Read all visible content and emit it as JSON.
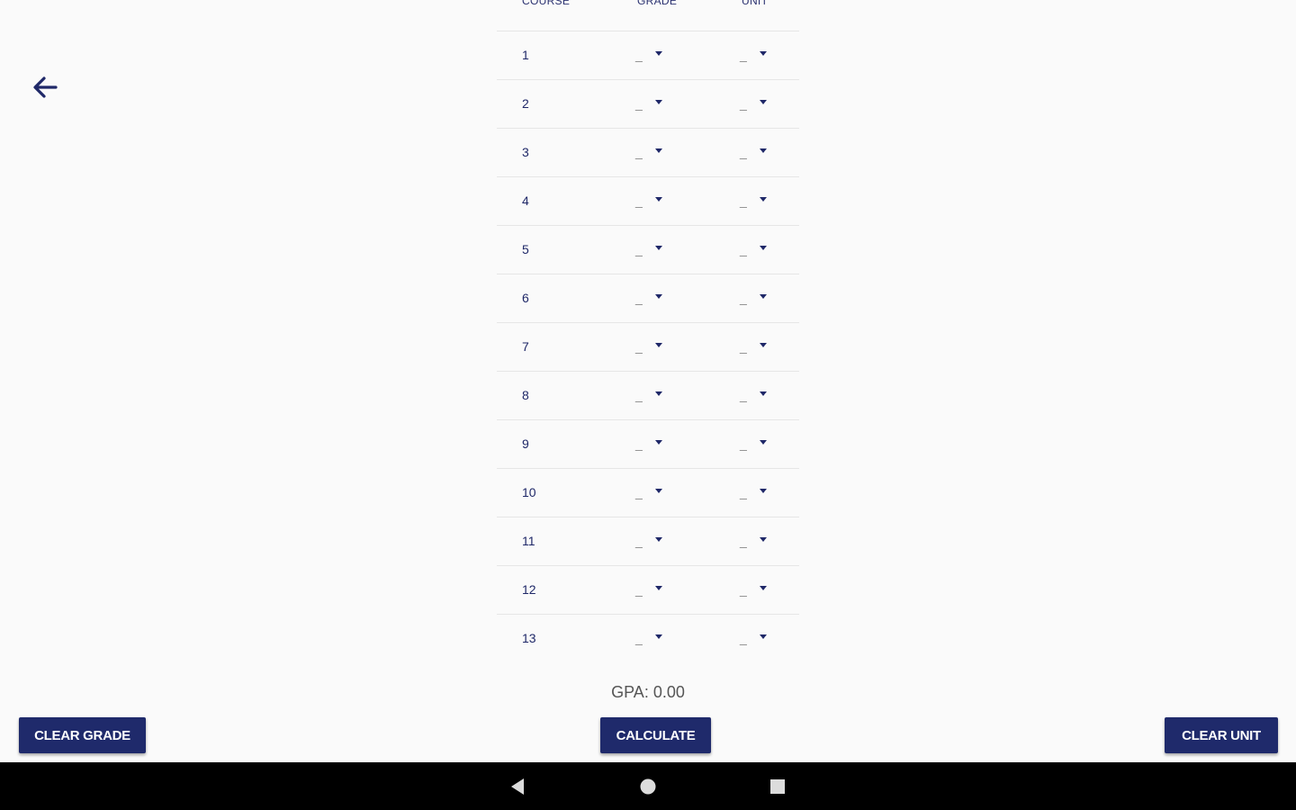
{
  "header": {
    "columns": {
      "course": "COURSE",
      "grade": "GRADE",
      "unit": "UNIT"
    }
  },
  "rows": [
    {
      "course": "1",
      "grade": "_",
      "unit": "_"
    },
    {
      "course": "2",
      "grade": "_",
      "unit": "_"
    },
    {
      "course": "3",
      "grade": "_",
      "unit": "_"
    },
    {
      "course": "4",
      "grade": "_",
      "unit": "_"
    },
    {
      "course": "5",
      "grade": "_",
      "unit": "_"
    },
    {
      "course": "6",
      "grade": "_",
      "unit": "_"
    },
    {
      "course": "7",
      "grade": "_",
      "unit": "_"
    },
    {
      "course": "8",
      "grade": "_",
      "unit": "_"
    },
    {
      "course": "9",
      "grade": "_",
      "unit": "_"
    },
    {
      "course": "10",
      "grade": "_",
      "unit": "_"
    },
    {
      "course": "11",
      "grade": "_",
      "unit": "_"
    },
    {
      "course": "12",
      "grade": "_",
      "unit": "_"
    },
    {
      "course": "13",
      "grade": "_",
      "unit": "_"
    }
  ],
  "result": {
    "gpa_text": "GPA: 0.00"
  },
  "buttons": {
    "clear_grade": "CLEAR GRADE",
    "calculate": "CALCULATE",
    "clear_unit": "CLEAR UNIT"
  },
  "icons": {
    "back": "arrow-left-icon",
    "nav_back": "nav-back-triangle-icon",
    "nav_home": "nav-home-circle-icon",
    "nav_recent": "nav-recent-square-icon"
  },
  "colors": {
    "primary": "#1f2a6b",
    "text_primary": "#1f2868",
    "background": "#fafafa",
    "navbar": "#000000"
  }
}
